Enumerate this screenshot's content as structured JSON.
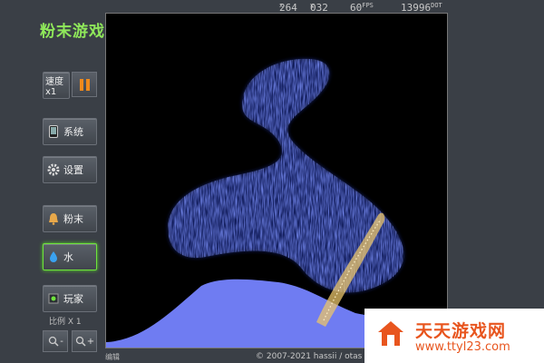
{
  "app_title": "粉末游戏",
  "topbar": {
    "x_prefix": "x",
    "x_value": "264",
    "y_prefix": "y",
    "y_value": "032",
    "fps_value": "60",
    "fps_unit": "FPS",
    "dot_value": "13996",
    "dot_unit": "DOT"
  },
  "sidebar": {
    "speed_label": "速度x1",
    "system_label": "系统",
    "settings_label": "设置",
    "powder_label": "粉末",
    "water_label": "水",
    "player_label": "玩家",
    "scale_label": "比例 X 1",
    "zoom_out": "-",
    "zoom_in": "+"
  },
  "footer": {
    "edit_label": "编辑",
    "copyright": "© 2007-2021 hassii / otas"
  },
  "watermark": {
    "name": "天天游戏网",
    "url": "www.ttyl23.com"
  },
  "colors": {
    "accent_green": "#6fe43c",
    "water_blue": "#3a4fd8",
    "pool_blue": "#6f7cf2",
    "powder_gold": "#e9c46a",
    "watermark_orange": "#e8551e"
  },
  "icons": {
    "system": "phone-icon",
    "settings": "gear-icon",
    "powder": "bell-icon",
    "water": "water-drop-icon",
    "player": "player-icon",
    "zoom_out": "magnifier-minus-icon",
    "zoom_in": "magnifier-plus-icon"
  }
}
